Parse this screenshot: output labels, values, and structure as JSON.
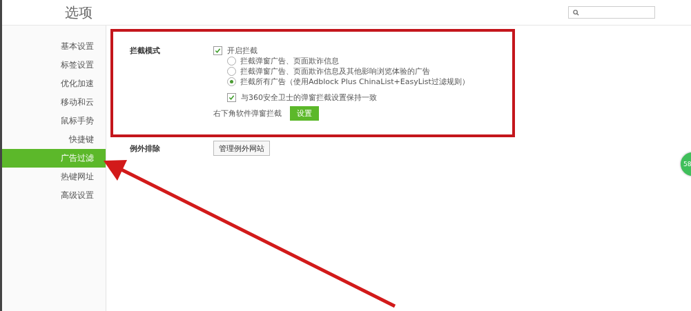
{
  "window": {
    "title": "选项"
  },
  "search": {
    "kind": "search"
  },
  "sidebar": {
    "items": [
      {
        "label": "基本设置",
        "selected": false
      },
      {
        "label": "标签设置",
        "selected": false
      },
      {
        "label": "优化加速",
        "selected": false
      },
      {
        "label": "移动和云",
        "selected": false
      },
      {
        "label": "鼠标手势",
        "selected": false
      },
      {
        "label": "快捷键",
        "selected": false
      },
      {
        "label": "广告过滤",
        "selected": true
      },
      {
        "label": "热键网址",
        "selected": false
      },
      {
        "label": "高级设置",
        "selected": false
      }
    ]
  },
  "block_mode": {
    "label": "拦截模式",
    "enable": {
      "label": "开启拦截",
      "checked": true
    },
    "options": [
      {
        "label": "拦截弹窗广告、页面欺诈信息",
        "selected": false
      },
      {
        "label": "拦截弹窗广告、页面欺诈信息及其他影响浏览体验的广告",
        "selected": false
      },
      {
        "label": "拦截所有广告（使用Adblock Plus ChinaList+EasyList过滤规则）",
        "selected": true
      }
    ],
    "sync": {
      "label": "与360安全卫士的弹窗拦截设置保持一致",
      "checked": true
    },
    "corner_popup": {
      "label": "右下角软件弹窗拦截",
      "button": "设置"
    }
  },
  "exceptions": {
    "label": "例外排除",
    "button": "管理例外网站"
  },
  "floating_ball": {
    "text": "58"
  }
}
